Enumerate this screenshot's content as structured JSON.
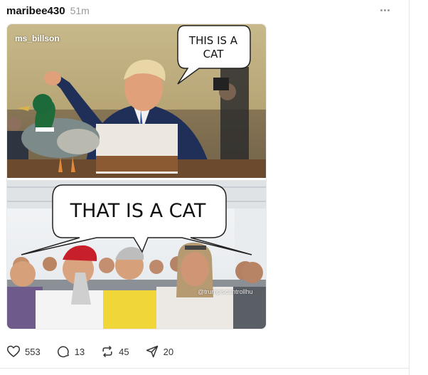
{
  "post": {
    "username": "maribee430",
    "timestamp": "51m"
  },
  "meme": {
    "credit": "ms_billson",
    "top_caption": "THIS IS A CAT",
    "bottom_caption": "THAT IS A CAT",
    "watermark": "@trumpiscantrollhu"
  },
  "actions": {
    "likes": "553",
    "comments": "13",
    "reposts": "45",
    "shares": "20"
  },
  "icons": {
    "like": "heart-icon",
    "comment": "speech-bubble-icon",
    "repost": "repost-arrows-icon",
    "share": "paper-plane-icon",
    "more": "more-options-icon"
  },
  "colors": {
    "username": "#101010",
    "muted": "#999999",
    "divider": "#e6e6e6"
  }
}
